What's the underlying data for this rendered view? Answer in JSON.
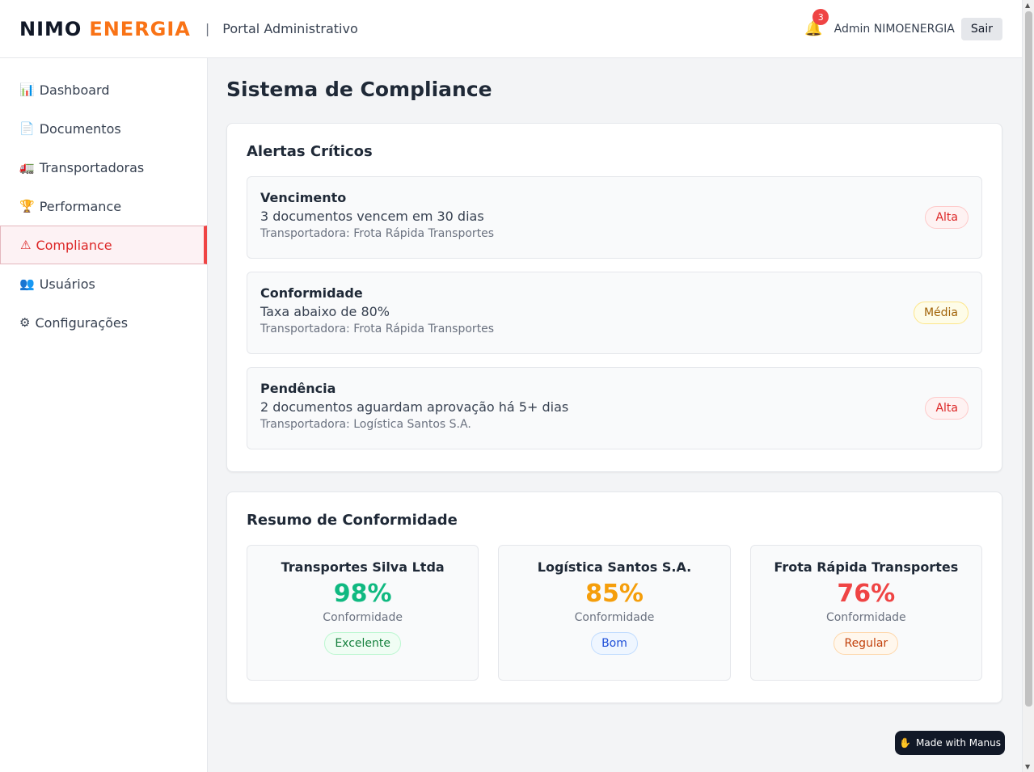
{
  "header": {
    "brand_part1": "NIMO",
    "brand_part2": "ENERGIA",
    "separator": "|",
    "subtitle": "Portal Administrativo",
    "notification_count": "3",
    "user_name": "Admin NIMOENERGIA",
    "logout_label": "Sair"
  },
  "sidebar": {
    "items": [
      {
        "icon": "📊",
        "icon_name": "chart-icon",
        "label": "Dashboard",
        "active": false
      },
      {
        "icon": "📄",
        "icon_name": "document-icon",
        "label": "Documentos",
        "active": false
      },
      {
        "icon": "🚛",
        "icon_name": "truck-icon",
        "label": "Transportadoras",
        "active": false
      },
      {
        "icon": "🏆",
        "icon_name": "trophy-icon",
        "label": "Performance",
        "active": false
      },
      {
        "icon": "⚠",
        "icon_name": "warning-icon",
        "label": "Compliance",
        "active": true
      },
      {
        "icon": "👥",
        "icon_name": "users-icon",
        "label": "Usuários",
        "active": false
      },
      {
        "icon": "⚙",
        "icon_name": "gear-icon",
        "label": "Configurações",
        "active": false
      }
    ]
  },
  "main": {
    "title": "Sistema de Compliance",
    "alerts": {
      "title": "Alertas Críticos",
      "items": [
        {
          "type": "Vencimento",
          "description": "3 documentos vencem em 30 dias",
          "carrier": "Transportadora: Frota Rápida Transportes",
          "priority": "Alta"
        },
        {
          "type": "Conformidade",
          "description": "Taxa abaixo de 80%",
          "carrier": "Transportadora: Frota Rápida Transportes",
          "priority": "Média"
        },
        {
          "type": "Pendência",
          "description": "2 documentos aguardam aprovação há 5+ dias",
          "carrier": "Transportadora: Logística Santos S.A.",
          "priority": "Alta"
        }
      ]
    },
    "summary": {
      "title": "Resumo de Conformidade",
      "items": [
        {
          "name": "Transportes Silva Ltda",
          "percent": "98%",
          "label": "Conformidade",
          "status": "Excelente",
          "color": "#10b981"
        },
        {
          "name": "Logística Santos S.A.",
          "percent": "85%",
          "label": "Conformidade",
          "status": "Bom",
          "color": "#f59e0b"
        },
        {
          "name": "Frota Rápida Transportes",
          "percent": "76%",
          "label": "Conformidade",
          "status": "Regular",
          "color": "#ef4444"
        }
      ]
    }
  },
  "footer_badge": {
    "icon": "✋",
    "label": "Made with Manus"
  }
}
